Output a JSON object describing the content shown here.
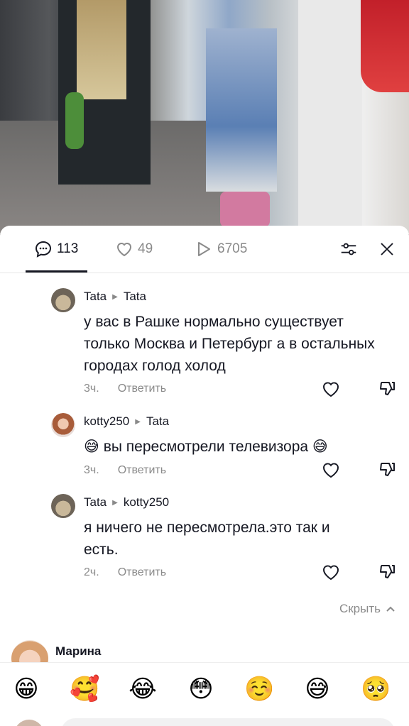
{
  "tabs": {
    "comments_count": "113",
    "likes_count": "49",
    "views_count": "6705"
  },
  "comments": [
    {
      "author": "Tata",
      "reply_to": "Tata",
      "text": "у вас в Рашке нормально существует только Москва и Петербург а в остальных городах голод холод",
      "time": "3ч.",
      "reply_label": "Ответить"
    },
    {
      "author": "kotty250",
      "reply_to": "Tata",
      "text": "😅 вы пересмотрели телевизора 😅",
      "time": "3ч.",
      "reply_label": "Ответить"
    },
    {
      "author": "Tata",
      "reply_to": "kotty250",
      "text": "я ничего не пересмотрела.это так и есть.",
      "time": "2ч.",
      "reply_label": "Ответить"
    }
  ],
  "hide_label": "Скрыть",
  "next_comment": {
    "author": "Марина"
  },
  "emojis": [
    "😁",
    "🥰",
    "😂",
    "😳",
    "☺️",
    "😅",
    "🥺"
  ],
  "colors": {
    "text": "#161823",
    "muted": "#8a8a8a",
    "background": "#ffffff"
  }
}
